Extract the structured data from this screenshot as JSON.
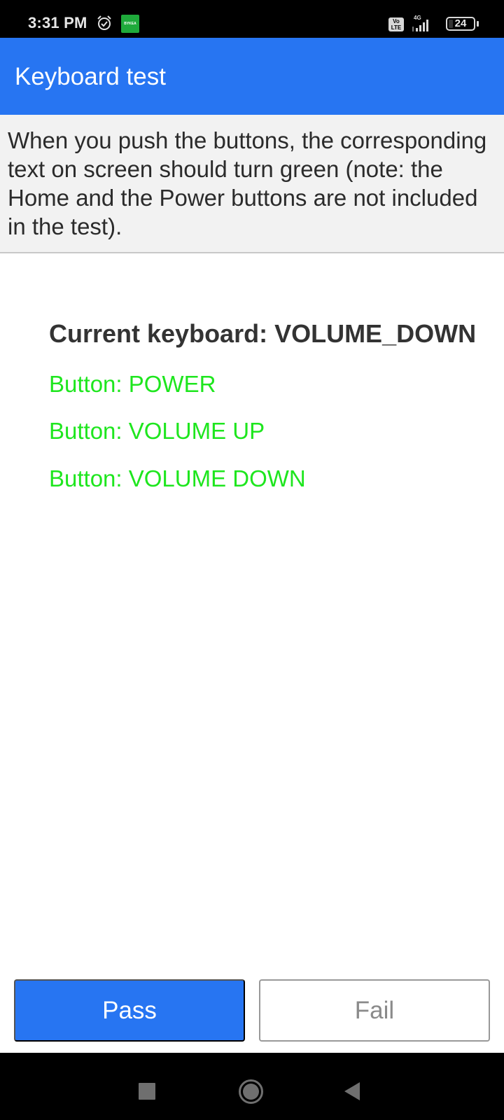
{
  "status_bar": {
    "time": "3:31 PM",
    "alarm_icon": "alarm-clock-icon",
    "app_badge": "BYKEA",
    "volte_label": "Vo LTE",
    "network_type": "4G",
    "signal_icon": "signal-bars-icon",
    "battery_level": "24"
  },
  "app_bar": {
    "title": "Keyboard test"
  },
  "instructions": {
    "text": "When you push the buttons, the corresponding text on screen should turn green (note: the Home and the Power buttons are not included in the test)."
  },
  "content": {
    "current_keyboard": "Current keyboard: VOLUME_DOWN",
    "buttons": [
      {
        "label": "Button: POWER",
        "status": "pressed"
      },
      {
        "label": "Button: VOLUME UP",
        "status": "pressed"
      },
      {
        "label": "Button: VOLUME DOWN",
        "status": "pressed"
      }
    ],
    "pressed_color": "#1ee61e"
  },
  "actions": {
    "pass_label": "Pass",
    "fail_label": "Fail"
  },
  "colors": {
    "accent": "#2775f2",
    "success_text": "#1ee61e"
  },
  "nav_bar": {
    "recents_icon": "square-recents-icon",
    "home_icon": "circle-home-icon",
    "back_icon": "triangle-back-icon"
  }
}
